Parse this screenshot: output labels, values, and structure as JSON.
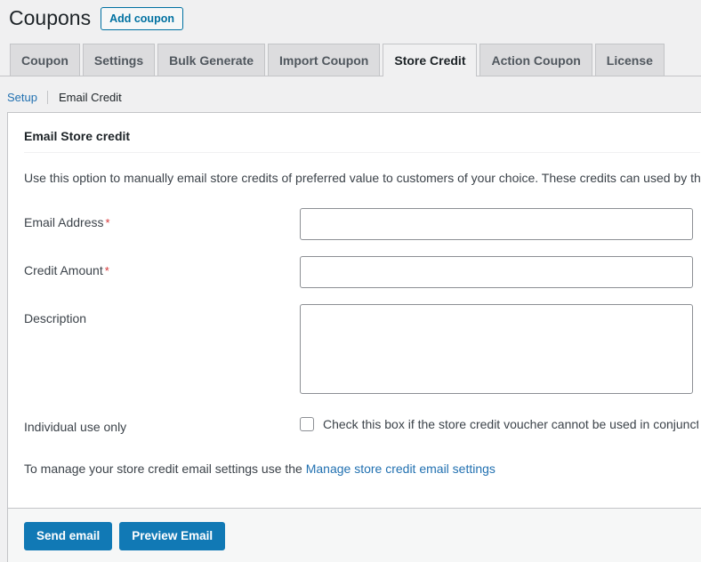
{
  "header": {
    "title": "Coupons",
    "add_button_label": "Add coupon"
  },
  "tabs": [
    {
      "label": "Coupon",
      "active": false
    },
    {
      "label": "Settings",
      "active": false
    },
    {
      "label": "Bulk Generate",
      "active": false
    },
    {
      "label": "Import Coupon",
      "active": false
    },
    {
      "label": "Store Credit",
      "active": true
    },
    {
      "label": "Action Coupon",
      "active": false
    },
    {
      "label": "License",
      "active": false
    }
  ],
  "subnav": {
    "setup_label": "Setup",
    "current_label": "Email Credit"
  },
  "panel": {
    "section_title": "Email Store credit",
    "description": "Use this option to manually email store credits of preferred value to customers of your choice. These credits can used by the customers",
    "fields": {
      "email": {
        "label": "Email Address",
        "required_mark": "*",
        "value": "",
        "placeholder": ""
      },
      "credit_amount": {
        "label": "Credit Amount",
        "required_mark": "*",
        "value": "",
        "placeholder": ""
      },
      "description": {
        "label": "Description",
        "value": "",
        "placeholder": ""
      },
      "individual_use": {
        "label": "Individual use only",
        "checkbox_label": "Check this box if the store credit voucher cannot be used in conjunction with other coupons",
        "checked": false
      }
    },
    "manage_prefix": "To manage your store credit email settings use the ",
    "manage_link_label": "Manage store credit email settings"
  },
  "footer": {
    "send_label": "Send email",
    "preview_label": "Preview Email"
  },
  "colors": {
    "accent_blue": "#2271b1",
    "button_blue": "#1179b5",
    "link_blue": "#0071a1",
    "required_red": "#d63638",
    "page_bg": "#f0f0f1",
    "panel_bg": "#ffffff",
    "tab_bg": "#dcdcde",
    "border_gray": "#c3c4c7"
  }
}
